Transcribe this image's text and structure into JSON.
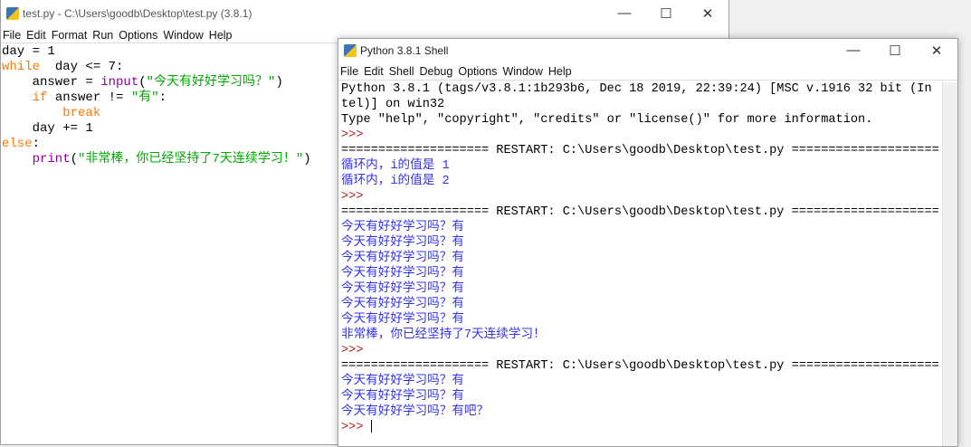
{
  "editor": {
    "title": "test.py - C:\\Users\\goodb\\Desktop\\test.py (3.8.1)",
    "menu": [
      "File",
      "Edit",
      "Format",
      "Run",
      "Options",
      "Window",
      "Help"
    ],
    "code": [
      [
        [
          "",
          "day = 1"
        ]
      ],
      [
        [
          "kw",
          "while"
        ],
        [
          "",
          "  day <= 7:"
        ]
      ],
      [
        [
          "",
          "    answer = "
        ],
        [
          "bi",
          "input"
        ],
        [
          "",
          "("
        ],
        [
          "st",
          "\"今天有好好学习吗？\""
        ],
        [
          "",
          ")"
        ]
      ],
      [
        [
          "kw",
          "    if"
        ],
        [
          "",
          " answer != "
        ],
        [
          "st",
          "\"有\""
        ],
        [
          "",
          ":"
        ]
      ],
      [
        [
          "kw",
          "        break"
        ]
      ],
      [
        [
          "",
          "    day += 1"
        ]
      ],
      [
        [
          "kw",
          "else"
        ],
        [
          "",
          ":"
        ]
      ],
      [
        [
          "bi",
          "    print"
        ],
        [
          "",
          "("
        ],
        [
          "st",
          "\"非常棒，你已经坚持了7天连续学习！\""
        ],
        [
          "",
          ")"
        ]
      ]
    ]
  },
  "shell": {
    "title": "Python 3.8.1 Shell",
    "menu": [
      "File",
      "Edit",
      "Shell",
      "Debug",
      "Options",
      "Window",
      "Help"
    ],
    "lines": [
      [
        "",
        "Python 3.8.1 (tags/v3.8.1:1b293b6, Dec 18 2019, 22:39:24) [MSC v.1916 32 bit (In"
      ],
      [
        "",
        "tel)] on win32"
      ],
      [
        "",
        "Type \"help\", \"copyright\", \"credits\" or \"license()\" for more information."
      ],
      [
        "pr",
        ">>>"
      ],
      [
        "",
        "==================== RESTART: C:\\Users\\goodb\\Desktop\\test.py ===================="
      ],
      [
        "out",
        "循环内，i的值是 1"
      ],
      [
        "out",
        "循环内，i的值是 2"
      ],
      [
        "pr",
        ">>>"
      ],
      [
        "",
        "==================== RESTART: C:\\Users\\goodb\\Desktop\\test.py ===================="
      ],
      [
        "out",
        "今天有好好学习吗？有"
      ],
      [
        "out",
        "今天有好好学习吗？有"
      ],
      [
        "out",
        "今天有好好学习吗？有"
      ],
      [
        "out",
        "今天有好好学习吗？有"
      ],
      [
        "out",
        "今天有好好学习吗？有"
      ],
      [
        "out",
        "今天有好好学习吗？有"
      ],
      [
        "out",
        "今天有好好学习吗？有"
      ],
      [
        "out",
        "非常棒，你已经坚持了7天连续学习！"
      ],
      [
        "pr",
        ">>>"
      ],
      [
        "",
        "==================== RESTART: C:\\Users\\goodb\\Desktop\\test.py ===================="
      ],
      [
        "out",
        "今天有好好学习吗？有"
      ],
      [
        "out",
        "今天有好好学习吗？有"
      ],
      [
        "out",
        "今天有好好学习吗？有吧？"
      ],
      [
        "pr",
        ">>> "
      ]
    ]
  },
  "controls": {
    "min": "—",
    "max": "☐",
    "close": "✕"
  }
}
